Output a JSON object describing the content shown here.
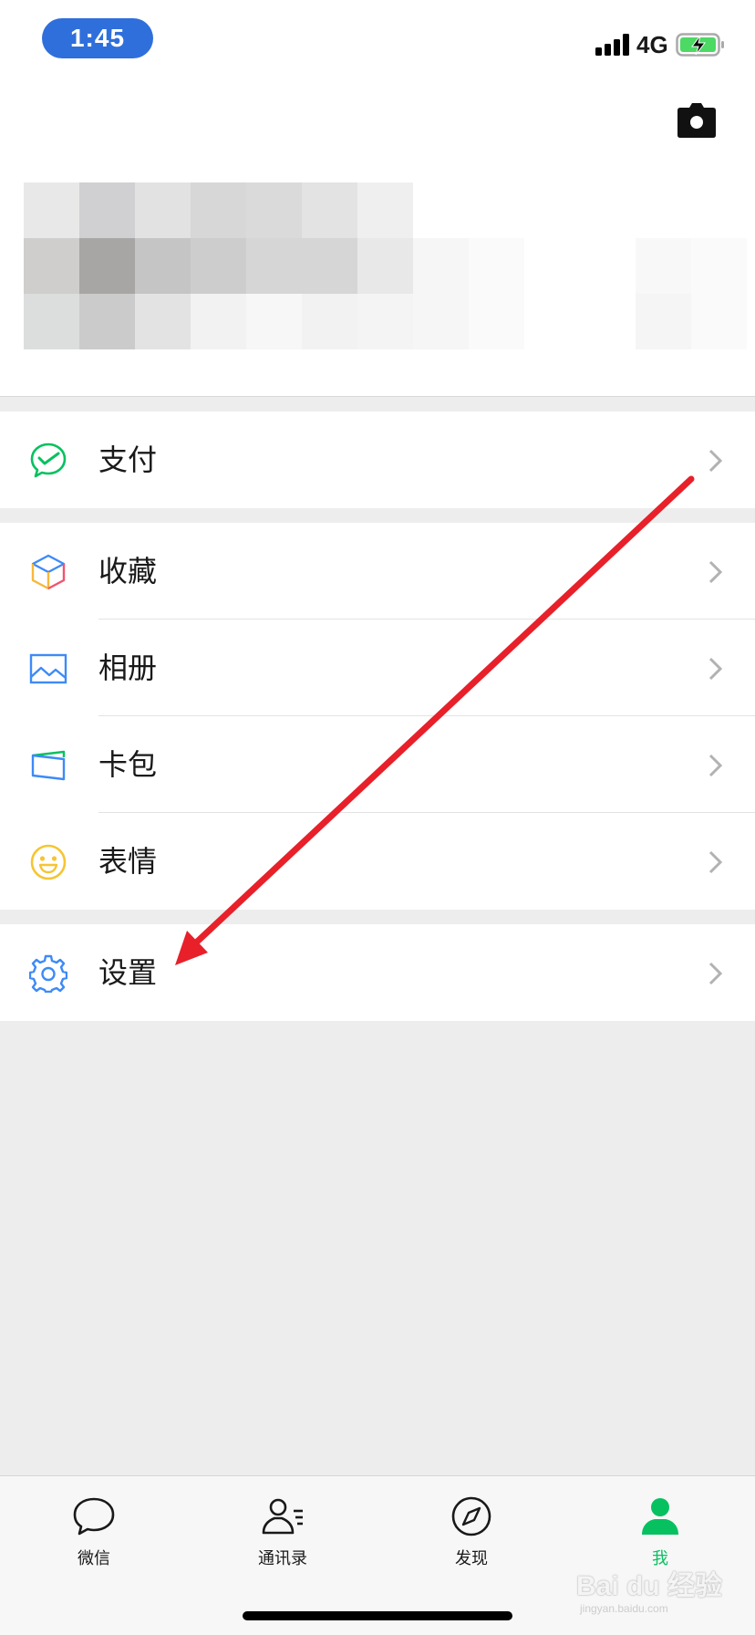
{
  "status_bar": {
    "time": "1:45",
    "network": "4G"
  },
  "profile": {
    "camera_icon": "camera-icon"
  },
  "menu": {
    "pay": "支付",
    "favorites": "收藏",
    "album": "相册",
    "cards": "卡包",
    "stickers": "表情",
    "settings": "设置"
  },
  "tabbar": {
    "chats": "微信",
    "contacts": "通讯录",
    "discover": "发现",
    "me": "我",
    "active": "me"
  },
  "watermark": {
    "text": "Bai du 经验",
    "sub": "jingyan.baidu.com"
  },
  "colors": {
    "accent": "#07c160",
    "annotation": "#e8202a",
    "time_pill": "#2f6fdc"
  }
}
